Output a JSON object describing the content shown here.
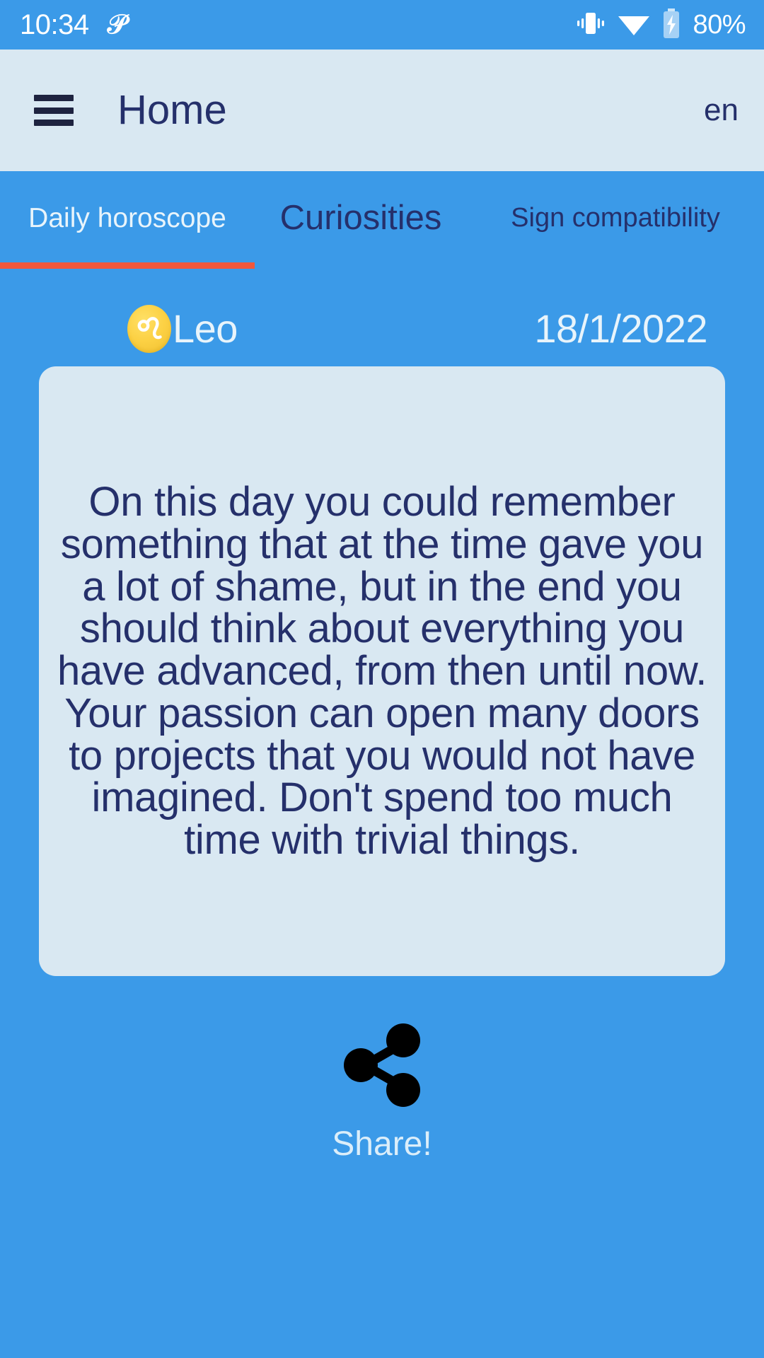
{
  "status_bar": {
    "time": "10:34",
    "app_icon": "pinterest-p-icon",
    "vibrate_icon": "vibrate-icon",
    "wifi_icon": "wifi-icon",
    "battery_icon": "battery-charging-icon",
    "battery_percent": "80%"
  },
  "app_bar": {
    "menu_icon": "hamburger-menu-icon",
    "title": "Home",
    "language": "en"
  },
  "tabs": {
    "items": [
      {
        "label": "Daily horoscope",
        "selected": true
      },
      {
        "label": "Curiosities",
        "selected": false
      },
      {
        "label": "Sign compatibility",
        "selected": false
      }
    ],
    "indicator_color": "#f0573c"
  },
  "main": {
    "sign_icon": "leo-zodiac-icon",
    "sign_name": "Leo",
    "date": "18/1/2022",
    "horoscope_text": "On this day you could remember something that at the time gave you a lot of shame, but in the end you should think about everything you have advanced, from then until now. Your passion can open many doors to projects that you would not have imagined. Don't spend too much time with trivial things."
  },
  "share": {
    "icon": "share-icon",
    "label": "Share!"
  },
  "colors": {
    "background": "#3b9ae8",
    "surface": "#d9e8f2",
    "on_surface": "#25306b",
    "accent": "#f0573c",
    "zodiac_badge": "#fcd144"
  }
}
